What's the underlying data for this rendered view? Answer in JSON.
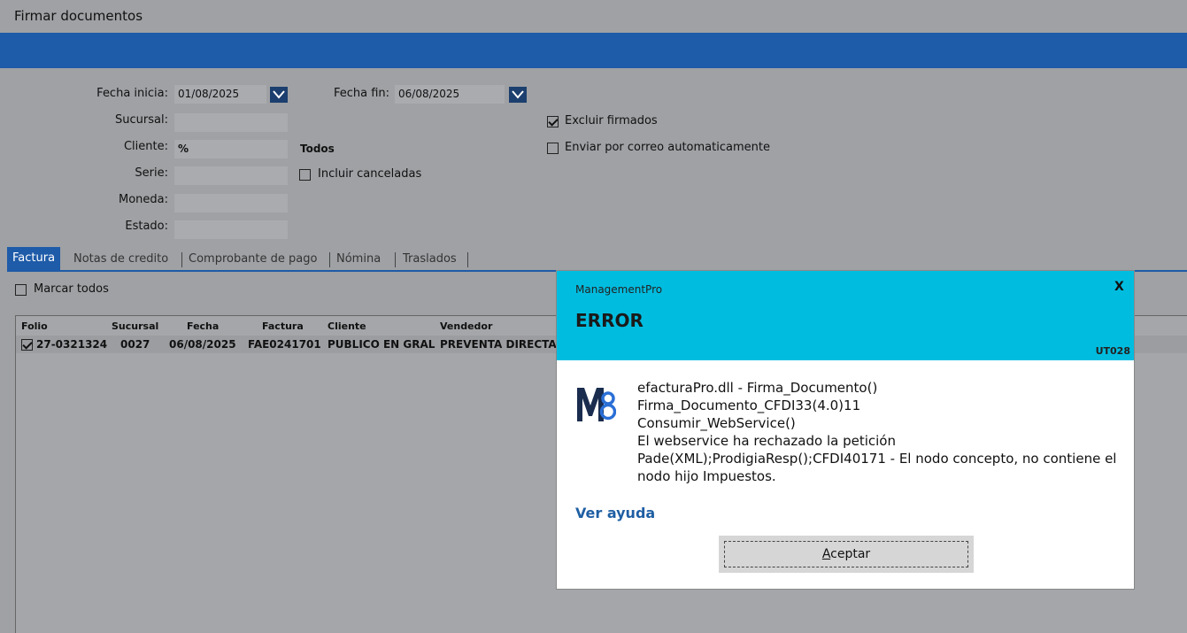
{
  "window": {
    "title": "Firmar documentos"
  },
  "filters": {
    "fecha_inicia_label": "Fecha inicia:",
    "fecha_inicia_value": "01/08/2025",
    "fecha_fin_label": "Fecha fin:",
    "fecha_fin_value": "06/08/2025",
    "sucursal_label": "Sucursal:",
    "sucursal_value": "",
    "cliente_label": "Cliente:",
    "cliente_value": "%",
    "cliente_desc": "Todos",
    "serie_label": "Serie:",
    "serie_value": "",
    "moneda_label": "Moneda:",
    "moneda_value": "",
    "estado_label": "Estado:",
    "estado_value": "",
    "incluir_canceladas_label": "Incluir canceladas",
    "incluir_canceladas_checked": false,
    "excluir_firmados_label": "Excluir firmados",
    "excluir_firmados_checked": true,
    "enviar_correo_label": "Enviar por correo automaticamente",
    "enviar_correo_checked": false
  },
  "tabs": [
    {
      "label": "Factura",
      "active": true
    },
    {
      "label": "Notas de credito",
      "active": false
    },
    {
      "label": "Comprobante de pago",
      "active": false
    },
    {
      "label": "Nómina",
      "active": false
    },
    {
      "label": "Traslados",
      "active": false
    }
  ],
  "marcar_todos": {
    "label": "Marcar todos",
    "checked": false
  },
  "table": {
    "columns": [
      "Folio",
      "Sucursal",
      "Fecha",
      "Factura",
      "Cliente",
      "Vendedor"
    ],
    "rows": [
      {
        "checked": true,
        "folio": "27-0321324",
        "sucursal": "0027",
        "fecha": "06/08/2025",
        "factura": "FAE0241701",
        "cliente": "PUBLICO EN GRAL",
        "vendedor": "PREVENTA DIRECTA"
      }
    ]
  },
  "dialog": {
    "app_name": "ManagementPro",
    "close_label": "X",
    "title": "ERROR",
    "code": "UT028",
    "message_lines": [
      "efacturaPro.dll - Firma_Documento()",
      "Firma_Documento_CFDI33(4.0)11",
      "Consumir_WebService()",
      "El webservice ha rechazado la petición",
      "Pade(XML);ProdigiaResp();CFDI40171 - El nodo concepto, no contiene el",
      "nodo hijo Impuestos."
    ],
    "help_link": "Ver ayuda",
    "accept_prefix": "A",
    "accept_rest": "ceptar",
    "logo_letters": "M8",
    "header_color": "#00bde0",
    "logo_color": "#1a2d4f"
  }
}
